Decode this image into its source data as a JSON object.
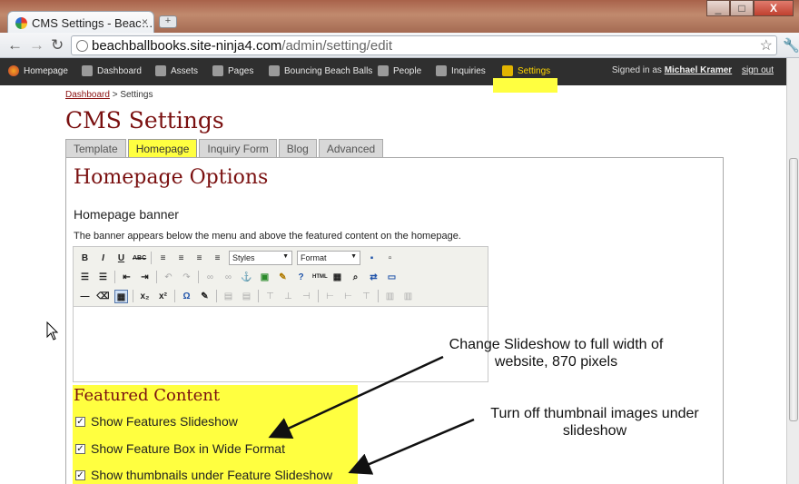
{
  "browser": {
    "tab_title": "CMS Settings - Beac…",
    "tab_close": "×",
    "new_tab": "+",
    "url_host": "beachballbooks.site-ninja4.com",
    "url_path": "/admin/setting/edit",
    "back": "←",
    "forward": "→",
    "reload": "↻",
    "star": "☆",
    "wrench": "🔧",
    "minimize": "_",
    "maximize": "□",
    "close": "X"
  },
  "cms_nav": {
    "items": [
      {
        "label": "Homepage",
        "icon": "globe-icon"
      },
      {
        "label": "Dashboard",
        "icon": "home-icon"
      },
      {
        "label": "Assets",
        "icon": "folder-icon"
      },
      {
        "label": "Pages",
        "icon": "pages-icon"
      },
      {
        "label": "Bouncing Beach Balls",
        "icon": "pencil-icon"
      },
      {
        "label": "People",
        "icon": "person-icon"
      },
      {
        "label": "Inquiries",
        "icon": "chat-icon"
      },
      {
        "label": "Settings",
        "icon": "gear-icon"
      }
    ],
    "signed_in_prefix": "Signed in as",
    "user": "Michael Kramer",
    "sign_out": "sign out"
  },
  "breadcrumb": {
    "link": "Dashboard",
    "sep": ">",
    "current": "Settings"
  },
  "page_title": "CMS Settings",
  "tabs": [
    {
      "label": "Template"
    },
    {
      "label": "Homepage"
    },
    {
      "label": "Inquiry Form"
    },
    {
      "label": "Blog"
    },
    {
      "label": "Advanced"
    }
  ],
  "section_title": "Homepage Options",
  "banner": {
    "label": "Homepage banner",
    "description": "The banner appears below the menu and above the featured content on the homepage."
  },
  "editor": {
    "styles_label": "Styles",
    "format_label": "Format"
  },
  "featured": {
    "title": "Featured Content",
    "options": [
      {
        "label": "Show Features Slideshow",
        "checked": "✓"
      },
      {
        "label": "Show Feature Box in Wide Format",
        "checked": "✓"
      },
      {
        "label": "Show thumbnails under Feature Slideshow",
        "checked": "✓"
      }
    ]
  },
  "annotations": {
    "one_line1": "Change Slideshow to full width of",
    "one_line2": "website, 870 pixels",
    "two_line1": "Turn off thumbnail images under",
    "two_line2": "slideshow"
  },
  "colors": {
    "accent_red": "#7a1010",
    "highlight": "#ffff40",
    "nav_bg": "#2f2f2f"
  }
}
